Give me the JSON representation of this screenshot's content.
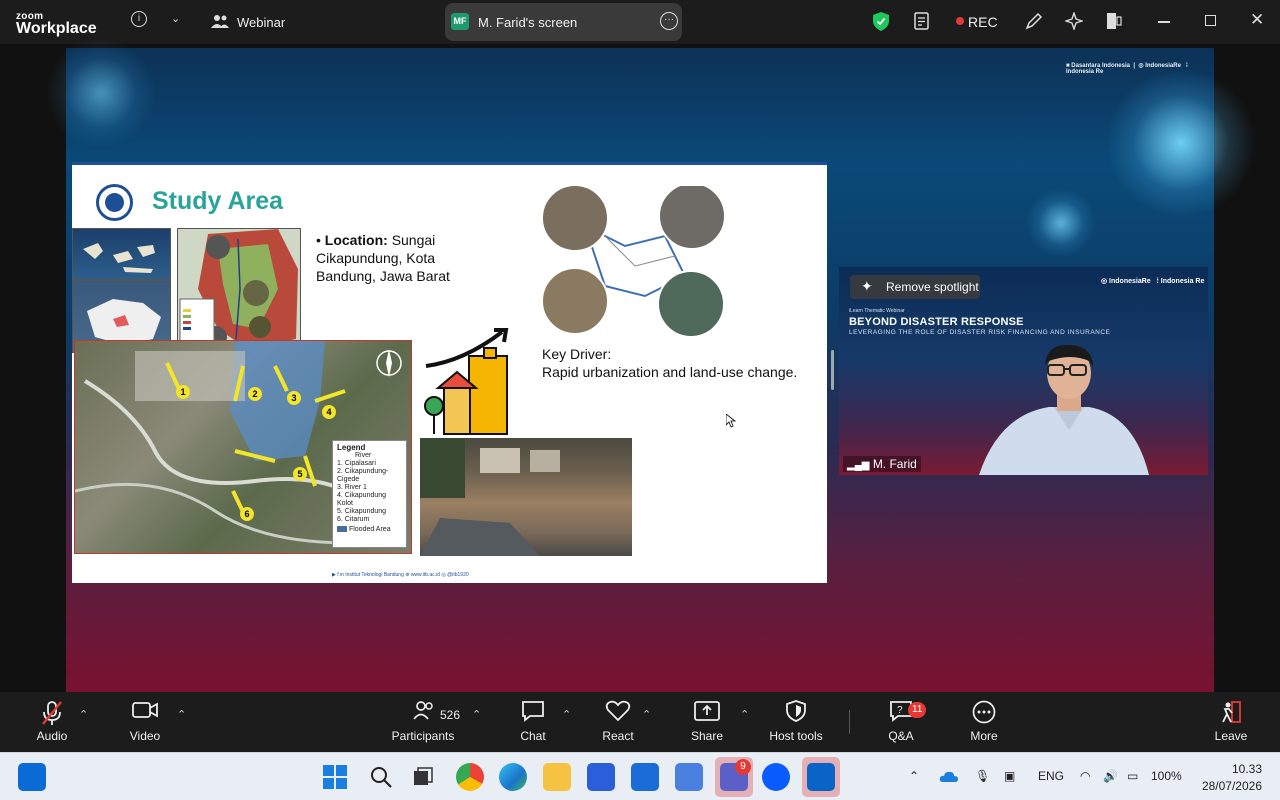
{
  "topbar": {
    "logo_line1": "zoom",
    "logo_line2": "Workplace",
    "webinar_label": "Webinar",
    "share_badge": "MF",
    "share_title": "M. Farid's screen",
    "rec_label": "REC"
  },
  "slide": {
    "title": "Study Area",
    "location_bold": "Location:",
    "location_text": "Sungai Cikapundung, Kota Bandung, Jawa Barat",
    "key_driver_label": "Key Driver:",
    "key_driver_text": "Rapid urbanization and land-use change.",
    "legend": {
      "title": "Legend",
      "subtitle": "River",
      "items": [
        "1. Cipalasari",
        "2. Cikapundung-Cigede",
        "3. River 1",
        "4. Cikapundung Kolot",
        "5. Cikapundung",
        "6. Citarum"
      ],
      "flooded": "Flooded Area"
    },
    "markers": [
      "1",
      "2",
      "3",
      "4",
      "5",
      "6"
    ],
    "footer": "Institut Teknologi Bandung"
  },
  "video": {
    "remove_spotlight": "Remove spotlight",
    "subtitle": "iLearn Thematic Webinar",
    "title": "BEYOND DISASTER RESPONSE",
    "tagline": "LEVERAGING THE ROLE OF DISASTER RISK FINANCING AND INSURANCE",
    "participant_name": "M. Farid"
  },
  "toolbar": {
    "audio": "Audio",
    "video": "Video",
    "participants": "Participants",
    "participants_count": "526",
    "chat": "Chat",
    "react": "React",
    "share": "Share",
    "host_tools": "Host tools",
    "qa": "Q&A",
    "qa_badge": "11",
    "more": "More",
    "leave": "Leave"
  },
  "taskbar": {
    "teams_badge": "9",
    "lang": "ENG",
    "battery": "100%",
    "time": "10.33",
    "date": "28/07/2026"
  },
  "colors": {
    "accent_green": "#1f9a6f",
    "rec_red": "#e53935",
    "slide_title_teal": "#2aa39a"
  }
}
